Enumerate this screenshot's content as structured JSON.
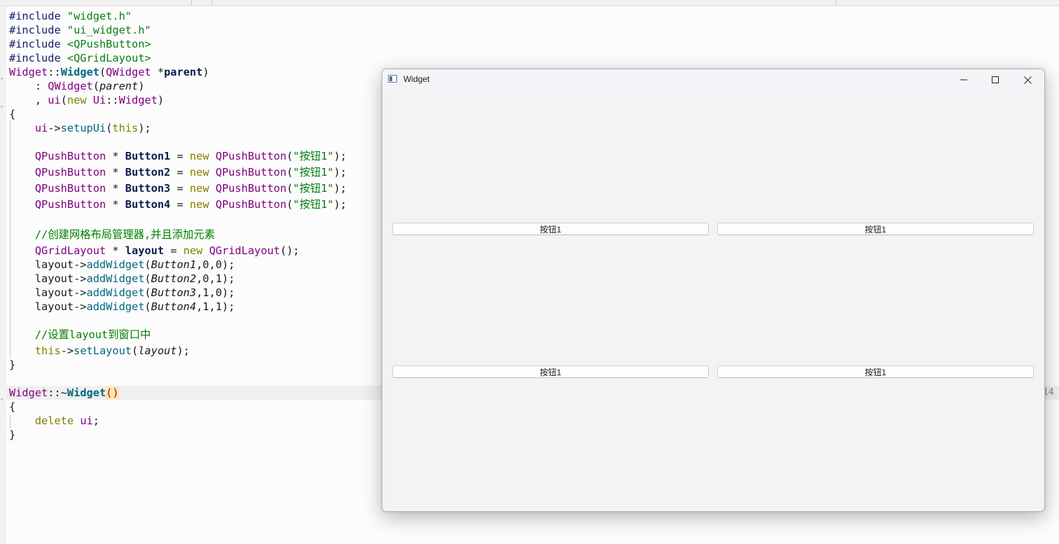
{
  "editor": {
    "lines": [
      [
        {
          "c": "tk-pp",
          "t": "#include "
        },
        {
          "c": "tk-str",
          "t": "\"widget.h\""
        }
      ],
      [
        {
          "c": "tk-pp",
          "t": "#include "
        },
        {
          "c": "tk-str",
          "t": "\"ui_widget.h\""
        }
      ],
      [
        {
          "c": "tk-pp",
          "t": "#include "
        },
        {
          "c": "tk-str",
          "t": "<QPushButton>"
        }
      ],
      [
        {
          "c": "tk-pp",
          "t": "#include "
        },
        {
          "c": "tk-str",
          "t": "<QGridLayout>"
        }
      ],
      [
        {
          "c": "tk-type",
          "t": "Widget"
        },
        {
          "c": "tk-plain",
          "t": "::"
        },
        {
          "c": "tk-bold-fn",
          "t": "Widget"
        },
        {
          "c": "tk-plain",
          "t": "("
        },
        {
          "c": "tk-type",
          "t": "QWidget"
        },
        {
          "c": "tk-plain",
          "t": " *"
        },
        {
          "c": "tk-bold",
          "t": "parent"
        },
        {
          "c": "tk-plain",
          "t": ")"
        }
      ],
      [
        {
          "c": "tk-plain",
          "t": "    : "
        },
        {
          "c": "tk-type",
          "t": "QWidget"
        },
        {
          "c": "tk-plain",
          "t": "("
        },
        {
          "c": "tk-it",
          "t": "parent"
        },
        {
          "c": "tk-plain",
          "t": ")"
        }
      ],
      [
        {
          "c": "tk-plain",
          "t": "    , "
        },
        {
          "c": "tk-type",
          "t": "ui"
        },
        {
          "c": "tk-plain",
          "t": "("
        },
        {
          "c": "tk-kw",
          "t": "new"
        },
        {
          "c": "tk-plain",
          "t": " "
        },
        {
          "c": "tk-type",
          "t": "Ui"
        },
        {
          "c": "tk-plain",
          "t": "::"
        },
        {
          "c": "tk-type",
          "t": "Widget"
        },
        {
          "c": "tk-plain",
          "t": ")"
        }
      ],
      [
        {
          "c": "tk-plain",
          "t": "{"
        }
      ],
      [
        {
          "c": "tk-plain",
          "t": "    "
        },
        {
          "c": "tk-type",
          "t": "ui"
        },
        {
          "c": "tk-plain",
          "t": "->"
        },
        {
          "c": "tk-fn",
          "t": "setupUi"
        },
        {
          "c": "tk-plain",
          "t": "("
        },
        {
          "c": "tk-kw",
          "t": "this"
        },
        {
          "c": "tk-plain",
          "t": ");"
        }
      ],
      [],
      [
        {
          "c": "tk-plain",
          "t": "    "
        },
        {
          "c": "tk-type",
          "t": "QPushButton"
        },
        {
          "c": "tk-plain",
          "t": " * "
        },
        {
          "c": "tk-bold",
          "t": "Button1"
        },
        {
          "c": "tk-plain",
          "t": " = "
        },
        {
          "c": "tk-kw",
          "t": "new"
        },
        {
          "c": "tk-plain",
          "t": " "
        },
        {
          "c": "tk-type",
          "t": "QPushButton"
        },
        {
          "c": "tk-plain",
          "t": "("
        },
        {
          "c": "tk-str",
          "t": "\"按钮1\""
        },
        {
          "c": "tk-plain",
          "t": ");"
        }
      ],
      [
        {
          "c": "tk-plain",
          "t": "    "
        },
        {
          "c": "tk-type",
          "t": "QPushButton"
        },
        {
          "c": "tk-plain",
          "t": " * "
        },
        {
          "c": "tk-bold",
          "t": "Button2"
        },
        {
          "c": "tk-plain",
          "t": " = "
        },
        {
          "c": "tk-kw",
          "t": "new"
        },
        {
          "c": "tk-plain",
          "t": " "
        },
        {
          "c": "tk-type",
          "t": "QPushButton"
        },
        {
          "c": "tk-plain",
          "t": "("
        },
        {
          "c": "tk-str",
          "t": "\"按钮1\""
        },
        {
          "c": "tk-plain",
          "t": ");"
        }
      ],
      [
        {
          "c": "tk-plain",
          "t": "    "
        },
        {
          "c": "tk-type",
          "t": "QPushButton"
        },
        {
          "c": "tk-plain",
          "t": " * "
        },
        {
          "c": "tk-bold",
          "t": "Button3"
        },
        {
          "c": "tk-plain",
          "t": " = "
        },
        {
          "c": "tk-kw",
          "t": "new"
        },
        {
          "c": "tk-plain",
          "t": " "
        },
        {
          "c": "tk-type",
          "t": "QPushButton"
        },
        {
          "c": "tk-plain",
          "t": "("
        },
        {
          "c": "tk-str",
          "t": "\"按钮1\""
        },
        {
          "c": "tk-plain",
          "t": ");"
        }
      ],
      [
        {
          "c": "tk-plain",
          "t": "    "
        },
        {
          "c": "tk-type",
          "t": "QPushButton"
        },
        {
          "c": "tk-plain",
          "t": " * "
        },
        {
          "c": "tk-bold",
          "t": "Button4"
        },
        {
          "c": "tk-plain",
          "t": " = "
        },
        {
          "c": "tk-kw",
          "t": "new"
        },
        {
          "c": "tk-plain",
          "t": " "
        },
        {
          "c": "tk-type",
          "t": "QPushButton"
        },
        {
          "c": "tk-plain",
          "t": "("
        },
        {
          "c": "tk-str",
          "t": "\"按钮1\""
        },
        {
          "c": "tk-plain",
          "t": ");"
        }
      ],
      [],
      [
        {
          "c": "tk-plain",
          "t": "    "
        },
        {
          "c": "tk-cmt",
          "t": "//创建网格布局管理器,并且添加元素"
        }
      ],
      [
        {
          "c": "tk-plain",
          "t": "    "
        },
        {
          "c": "tk-type",
          "t": "QGridLayout"
        },
        {
          "c": "tk-plain",
          "t": " * "
        },
        {
          "c": "tk-bold",
          "t": "layout"
        },
        {
          "c": "tk-plain",
          "t": " = "
        },
        {
          "c": "tk-kw",
          "t": "new"
        },
        {
          "c": "tk-plain",
          "t": " "
        },
        {
          "c": "tk-type",
          "t": "QGridLayout"
        },
        {
          "c": "tk-plain",
          "t": "();"
        }
      ],
      [
        {
          "c": "tk-plain",
          "t": "    layout->"
        },
        {
          "c": "tk-fn",
          "t": "addWidget"
        },
        {
          "c": "tk-plain",
          "t": "("
        },
        {
          "c": "tk-it",
          "t": "Button1"
        },
        {
          "c": "tk-plain",
          "t": ",0,0);"
        }
      ],
      [
        {
          "c": "tk-plain",
          "t": "    layout->"
        },
        {
          "c": "tk-fn",
          "t": "addWidget"
        },
        {
          "c": "tk-plain",
          "t": "("
        },
        {
          "c": "tk-it",
          "t": "Button2"
        },
        {
          "c": "tk-plain",
          "t": ",0,1);"
        }
      ],
      [
        {
          "c": "tk-plain",
          "t": "    layout->"
        },
        {
          "c": "tk-fn",
          "t": "addWidget"
        },
        {
          "c": "tk-plain",
          "t": "("
        },
        {
          "c": "tk-it",
          "t": "Button3"
        },
        {
          "c": "tk-plain",
          "t": ",1,0);"
        }
      ],
      [
        {
          "c": "tk-plain",
          "t": "    layout->"
        },
        {
          "c": "tk-fn",
          "t": "addWidget"
        },
        {
          "c": "tk-plain",
          "t": "("
        },
        {
          "c": "tk-it",
          "t": "Button4"
        },
        {
          "c": "tk-plain",
          "t": ",1,1);"
        }
      ],
      [],
      [
        {
          "c": "tk-plain",
          "t": "    "
        },
        {
          "c": "tk-cmt",
          "t": "//设置layout到窗口中"
        }
      ],
      [
        {
          "c": "tk-plain",
          "t": "    "
        },
        {
          "c": "tk-kw",
          "t": "this"
        },
        {
          "c": "tk-plain",
          "t": "->"
        },
        {
          "c": "tk-fn",
          "t": "setLayout"
        },
        {
          "c": "tk-plain",
          "t": "("
        },
        {
          "c": "tk-it",
          "t": "layout"
        },
        {
          "c": "tk-plain",
          "t": ");"
        }
      ],
      [
        {
          "c": "tk-plain",
          "t": "}"
        }
      ],
      [],
      [
        {
          "c": "tk-type",
          "t": "Widget"
        },
        {
          "c": "tk-plain",
          "t": "::~"
        },
        {
          "c": "tk-bold-fn",
          "t": "Widget"
        },
        {
          "c": "tk-paren-hl",
          "t": "()"
        }
      ],
      [
        {
          "c": "tk-plain",
          "t": "{"
        }
      ],
      [
        {
          "c": "tk-plain",
          "t": "    "
        },
        {
          "c": "tk-kw",
          "t": "delete"
        },
        {
          "c": "tk-plain",
          "t": " "
        },
        {
          "c": "tk-type",
          "t": "ui"
        },
        {
          "c": "tk-plain",
          "t": ";"
        }
      ],
      [
        {
          "c": "tk-plain",
          "t": "}"
        }
      ]
    ],
    "edge_text": "14"
  },
  "window": {
    "title": "Widget",
    "buttons": [
      "按钮1",
      "按钮1",
      "按钮1",
      "按钮1"
    ]
  },
  "icons": {
    "app": "window-app-icon",
    "minimize": "minimize-icon",
    "maximize": "maximize-icon",
    "close": "close-icon"
  },
  "colors": {
    "string": "#0b7d14",
    "type": "#800080",
    "function": "#00677c",
    "keyword": "#808000",
    "comment": "#008000"
  }
}
